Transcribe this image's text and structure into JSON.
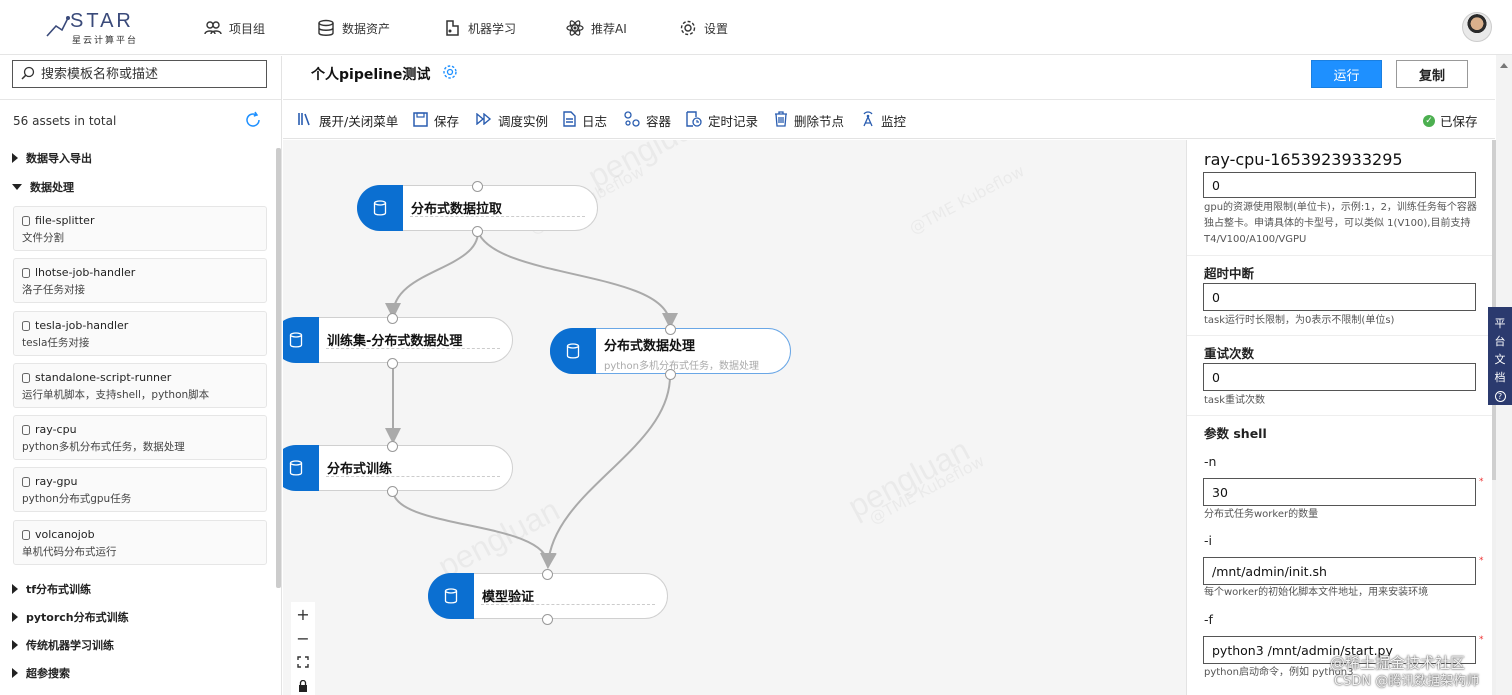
{
  "logo": {
    "brand": "STAR",
    "subtitle": "星云计算平台"
  },
  "nav": [
    {
      "label": "项目组",
      "icon": "users-icon"
    },
    {
      "label": "数据资产",
      "icon": "database-icon"
    },
    {
      "label": "机器学习",
      "icon": "ml-icon"
    },
    {
      "label": "推荐AI",
      "icon": "atom-icon"
    },
    {
      "label": "设置",
      "icon": "gear-icon"
    }
  ],
  "sidebar": {
    "search_placeholder": "搜索模板名称或描述",
    "assets_count": "56 assets in total",
    "groups": [
      {
        "label": "数据导入导出",
        "expanded": false
      },
      {
        "label": "数据处理",
        "expanded": true
      },
      {
        "label": "tf分布式训练",
        "expanded": false
      },
      {
        "label": "pytorch分布式训练",
        "expanded": false
      },
      {
        "label": "传统机器学习训练",
        "expanded": false
      },
      {
        "label": "超参搜索",
        "expanded": false
      }
    ],
    "cards": [
      {
        "name": "file-splitter",
        "desc": "文件分割"
      },
      {
        "name": "lhotse-job-handler",
        "desc": "洛子任务对接"
      },
      {
        "name": "tesla-job-handler",
        "desc": "tesla任务对接"
      },
      {
        "name": "standalone-script-runner",
        "desc": "运行单机脚本，支持shell，python脚本"
      },
      {
        "name": "ray-cpu",
        "desc": "python多机分布式任务，数据处理"
      },
      {
        "name": "ray-gpu",
        "desc": "python分布式gpu任务"
      },
      {
        "name": "volcanojob",
        "desc": "单机代码分布式运行"
      }
    ]
  },
  "pipeline": {
    "name": "个人pipeline测试",
    "run_label": "运行",
    "copy_label": "复制"
  },
  "toolbar": {
    "items": [
      "展开/关闭菜单",
      "保存",
      "调度实例",
      "日志",
      "容器",
      "定时记录",
      "删除节点",
      "监控"
    ],
    "saved": "已保存"
  },
  "canvas": {
    "watermark": "pengluan",
    "watermark_sub": "@TME Kubeflow",
    "nodes": [
      {
        "label": "分布式数据拉取",
        "desc": ""
      },
      {
        "label": "训练集-分布式数据处理",
        "desc": ""
      },
      {
        "label": "分布式数据处理",
        "desc": "python多机分布式任务，数据处理"
      },
      {
        "label": "分布式训练",
        "desc": ""
      },
      {
        "label": "模型验证",
        "desc": ""
      }
    ],
    "zoom": {
      "in": "+",
      "out": "−"
    }
  },
  "panel": {
    "title": "ray-cpu-1653923933295",
    "gpu_value": "0",
    "gpu_help": "gpu的资源使用限制(单位卡)，示例:1，2，训练任务每个容器独占整卡。申请具体的卡型号，可以类似 1(V100),目前支持T4/V100/A100/VGPU",
    "timeout_label": "超时中断",
    "timeout_value": "0",
    "timeout_help": "task运行时长限制，为0表示不限制(单位s)",
    "retry_label": "重试次数",
    "retry_value": "0",
    "retry_help": "task重试次数",
    "params_label": "参数 shell",
    "n_label": "-n",
    "n_value": "30",
    "n_help": "分布式任务worker的数量",
    "i_label": "-i",
    "i_value": "/mnt/admin/init.sh",
    "i_help": "每个worker的初始化脚本文件地址，用来安装环境",
    "f_label": "-f",
    "f_value": "python3 /mnt/admin/start.py",
    "f_help": "python启动命令，例如 python3"
  },
  "doc_tab": [
    "平",
    "台",
    "文",
    "档"
  ],
  "site_watermark": {
    "line1": "@稀土掘金技术社区",
    "line2": "CSDN @腾讯数据架构师"
  },
  "colors": {
    "accent": "#1e90ff",
    "node_cap": "#0b6fd1",
    "doc_tab": "#2b3a6e"
  }
}
